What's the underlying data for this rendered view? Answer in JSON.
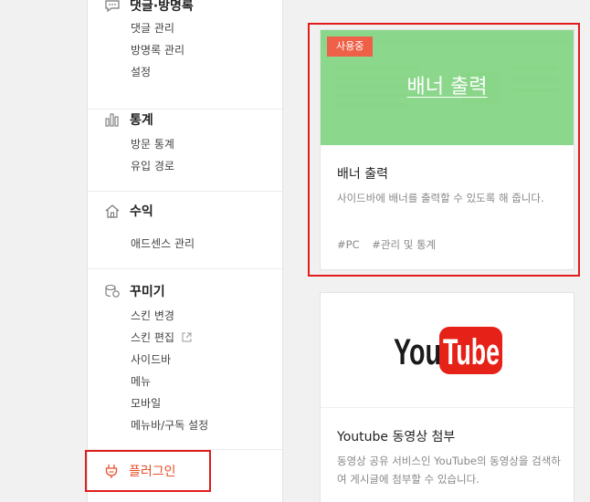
{
  "sidebar": {
    "comments": {
      "title": "댓글·방명록",
      "items": [
        "댓글 관리",
        "방명록 관리",
        "설정"
      ]
    },
    "stats": {
      "title": "통계",
      "items": [
        "방문 통계",
        "유입 경로"
      ]
    },
    "revenue": {
      "title": "수익",
      "items": [
        "애드센스 관리"
      ]
    },
    "design": {
      "title": "꾸미기",
      "items": [
        "스킨 변경",
        "스킨 편집",
        "사이드바",
        "메뉴",
        "모바일",
        "메뉴바/구독 설정"
      ]
    },
    "plugin": {
      "label": "플러그인"
    }
  },
  "plugins": [
    {
      "badge": "사용중",
      "thumb_caption": "배너 출력",
      "title": "배너 출력",
      "description": "사이드바에 배너를 출력할 수 있도록 해 줍니다.",
      "tags": [
        "#PC",
        "#관리 및 통계"
      ]
    },
    {
      "logo_text": {
        "you": "You",
        "tube": "Tube"
      },
      "title": "Youtube 동영상 첨부",
      "description": "동영상 공유 서비스인 YouTube의 동영상을 검색하여 게시글에 첨부할 수 있습니다."
    }
  ],
  "colors": {
    "accent_red": "#e8502c",
    "highlight_red": "#e01c1c",
    "banner_green": "#7fd47f",
    "youtube_red": "#e62117"
  }
}
